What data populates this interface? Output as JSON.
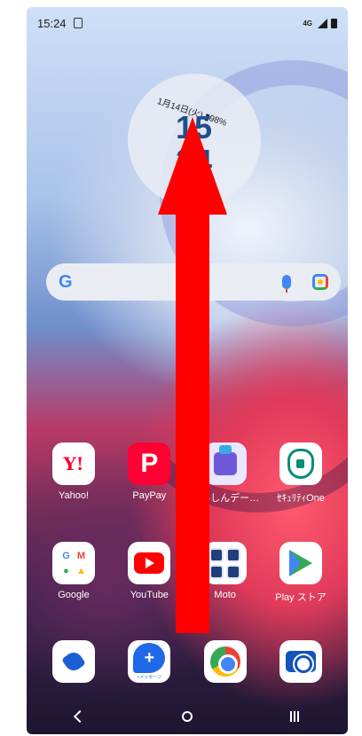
{
  "status_bar": {
    "time": "15:24",
    "network": "4G"
  },
  "clock_widget": {
    "date_battery": "1月14日(火) ▮98%",
    "hour": "15",
    "minute": "24"
  },
  "search": {
    "logo_g": "G"
  },
  "apps": [
    {
      "label": "Yahoo!",
      "icon": "yahoo-icon",
      "glyph": "Y!"
    },
    {
      "label": "PayPay",
      "icon": "paypay-icon",
      "glyph": "P"
    },
    {
      "label": "あんしんデー…",
      "icon": "anshin-data-icon"
    },
    {
      "label": "ｾｷｭﾘﾃｨOne",
      "icon": "shield-lock-icon"
    },
    {
      "label": "Google",
      "icon": "google-apps-folder-icon"
    },
    {
      "label": "YouTube",
      "icon": "youtube-icon"
    },
    {
      "label": "Moto",
      "icon": "moto-folder-icon"
    },
    {
      "label": "Play ストア",
      "icon": "play-store-icon"
    }
  ],
  "dock": [
    {
      "icon": "phone-icon"
    },
    {
      "icon": "plus-message-icon",
      "glyph": "+",
      "caption": "+メッセージ"
    },
    {
      "icon": "chrome-icon"
    },
    {
      "icon": "camera-icon"
    }
  ],
  "navigation": {
    "icons": [
      "back-icon",
      "home-icon",
      "recent-apps-icon"
    ]
  },
  "overlay": {
    "gesture": "swipe-up-arrow",
    "color": "#ff0000"
  }
}
